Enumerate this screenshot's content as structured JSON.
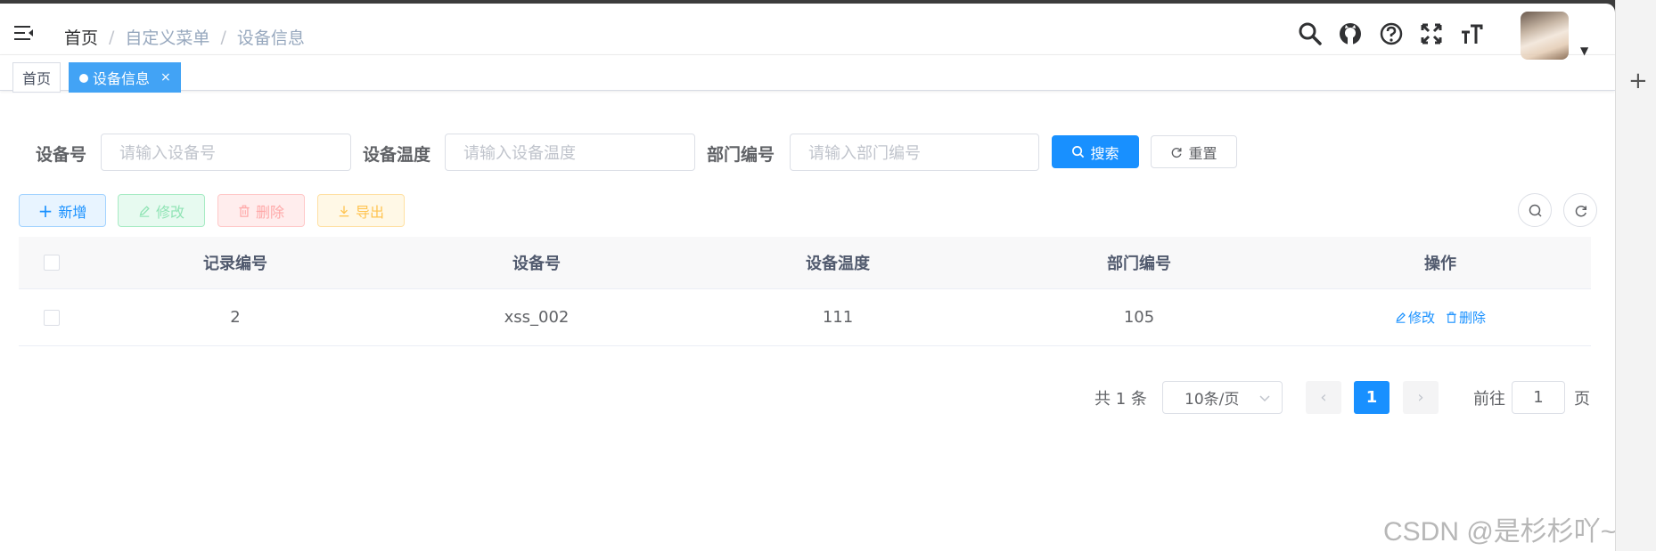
{
  "breadcrumb": [
    "首页",
    "自定义菜单",
    "设备信息"
  ],
  "tags": [
    {
      "label": "首页",
      "active": false
    },
    {
      "label": "设备信息",
      "active": true,
      "close": "×"
    }
  ],
  "search_form": {
    "fields": [
      {
        "label": "设备号",
        "placeholder": "请输入设备号"
      },
      {
        "label": "设备温度",
        "placeholder": "请输入设备温度"
      },
      {
        "label": "部门编号",
        "placeholder": "请输入部门编号"
      }
    ],
    "search_label": "搜索",
    "reset_label": "重置"
  },
  "toolbar": {
    "add": "新增",
    "edit": "修改",
    "delete": "删除",
    "export": "导出"
  },
  "table": {
    "columns": [
      "记录编号",
      "设备号",
      "设备温度",
      "部门编号",
      "操作"
    ],
    "rows": [
      {
        "id": "2",
        "device_no": "xss_002",
        "temperature": "111",
        "dept_no": "105",
        "actions": [
          "修改",
          "删除"
        ]
      }
    ]
  },
  "pagination": {
    "total_text": "共 1 条",
    "page_size": "10条/页",
    "current_page": "1",
    "goto_label": "前往",
    "goto_value": "1",
    "goto_suffix": "页"
  },
  "watermark": "CSDN @是杉杉吖~",
  "colors": {
    "primary": "#1890ff",
    "success": "#13ce66",
    "danger": "#ff4949",
    "warning": "#ffba00",
    "tag_active": "#42a3f5"
  }
}
